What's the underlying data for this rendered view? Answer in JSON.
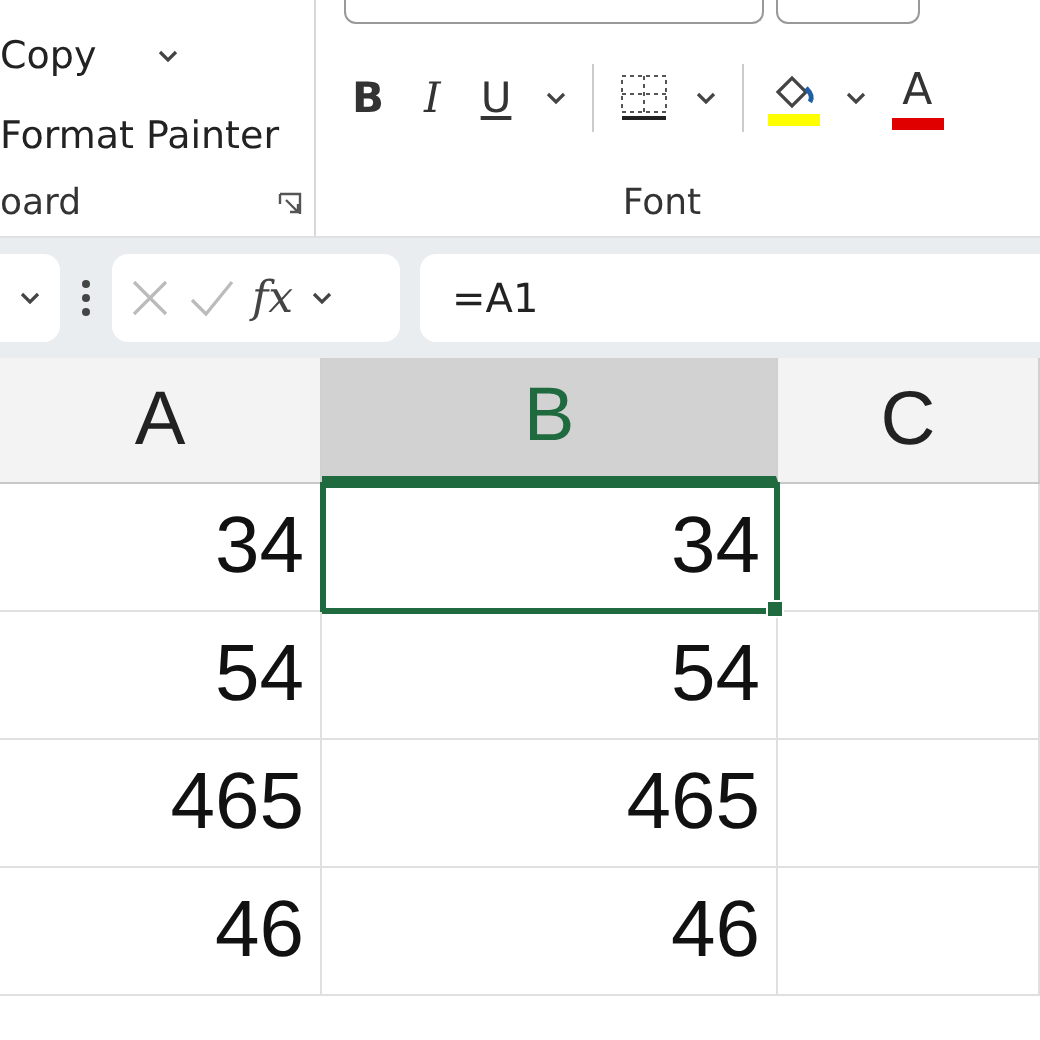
{
  "ribbon": {
    "clipboard_group": {
      "items": [
        {
          "label": "Copy",
          "kind": "dropdown"
        },
        {
          "label": "Format Painter",
          "kind": "plain"
        }
      ],
      "group_label": "oard"
    },
    "font_group": {
      "group_label": "Font",
      "buttons": [
        {
          "kind": "bold",
          "label": "B"
        },
        {
          "kind": "italic",
          "label": "I"
        },
        {
          "kind": "underline",
          "label": "U"
        },
        {
          "kind": "caret"
        },
        {
          "kind": "separator"
        },
        {
          "kind": "borders"
        },
        {
          "kind": "caret"
        },
        {
          "kind": "separator"
        },
        {
          "kind": "fill",
          "color": "#ffff00"
        },
        {
          "kind": "caret"
        },
        {
          "kind": "fontcolor",
          "label": "A",
          "color": "#e00000"
        }
      ]
    }
  },
  "formula_bar": {
    "fx": "fx",
    "value": "=A1"
  },
  "columns": [
    {
      "label": "A",
      "selected": false
    },
    {
      "label": "B",
      "selected": true
    },
    {
      "label": "C",
      "selected": false
    }
  ],
  "rows": [
    {
      "cells": [
        {
          "value": "34",
          "selected": false
        },
        {
          "value": "34",
          "selected": true
        }
      ]
    },
    {
      "cells": [
        {
          "value": "54",
          "selected": false
        },
        {
          "value": "54",
          "selected": false
        }
      ]
    },
    {
      "cells": [
        {
          "value": "465",
          "selected": false
        },
        {
          "value": "465",
          "selected": false
        }
      ]
    },
    {
      "cells": [
        {
          "value": "46",
          "selected": false
        },
        {
          "value": "46",
          "selected": false
        }
      ]
    }
  ]
}
